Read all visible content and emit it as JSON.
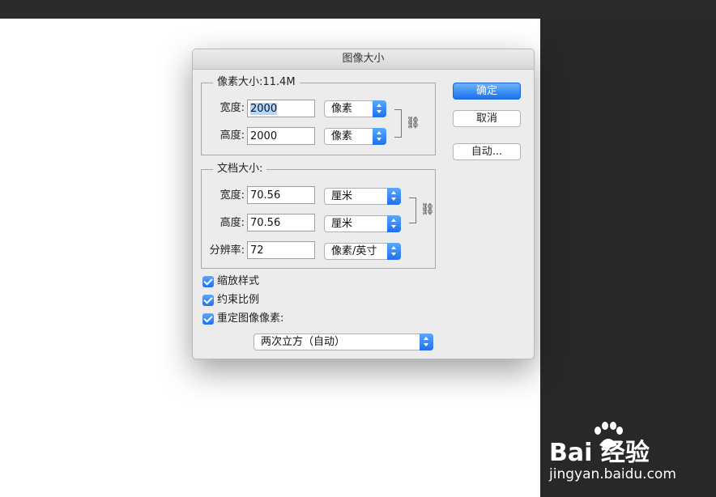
{
  "dialog": {
    "title": "图像大小",
    "pixel_group": {
      "title": "像素大小:11.4M",
      "width_label": "宽度:",
      "width_value": "2000",
      "width_unit": "像素",
      "height_label": "高度:",
      "height_value": "2000",
      "height_unit": "像素"
    },
    "doc_group": {
      "title": "文档大小:",
      "width_label": "宽度:",
      "width_value": "70.56",
      "width_unit": "厘米",
      "height_label": "高度:",
      "height_value": "70.56",
      "height_unit": "厘米",
      "resolution_label": "分辨率:",
      "resolution_value": "72",
      "resolution_unit": "像素/英寸"
    },
    "buttons": {
      "ok": "确定",
      "cancel": "取消",
      "auto": "自动..."
    },
    "checkboxes": [
      {
        "label": "缩放样式",
        "checked": true
      },
      {
        "label": "约束比例",
        "checked": true
      },
      {
        "label": "重定图像像素:",
        "checked": true
      }
    ],
    "resample_method": "两次立方（自动）"
  },
  "watermark": {
    "logo": "Bai 经验",
    "url": "jingyan.baidu.com"
  },
  "colors": {
    "accent": "#1f6ff0",
    "dialog_bg": "#ececec",
    "canvas": "#ffffff",
    "panel": "#282828"
  }
}
